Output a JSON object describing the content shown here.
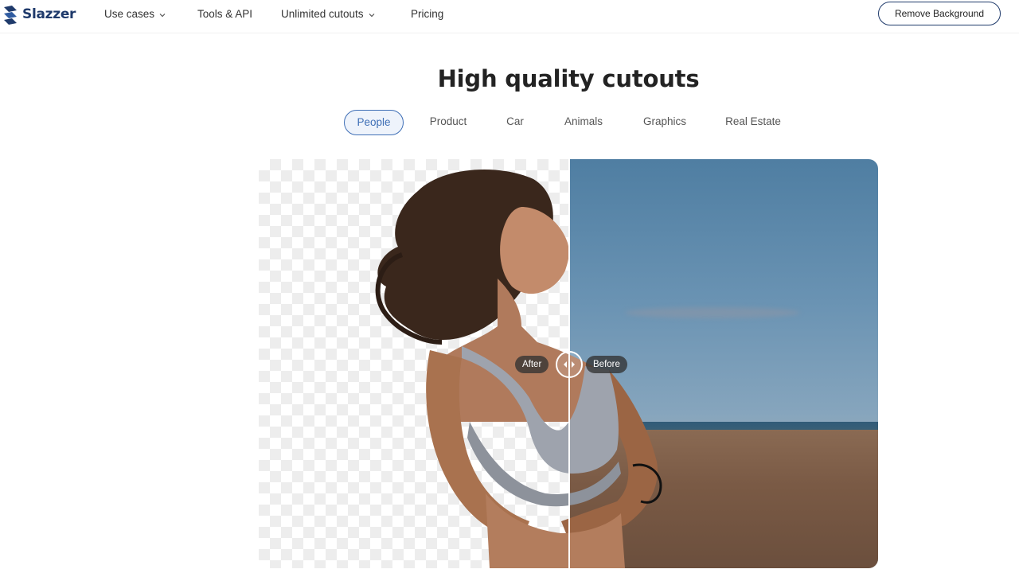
{
  "brand": {
    "name": "Slazzer",
    "logo_icon": "slazzer-logo-icon",
    "color": "#1f3a6b"
  },
  "nav": {
    "items": [
      {
        "label": "Use cases",
        "has_dropdown": true
      },
      {
        "label": "Tools & API",
        "has_dropdown": false
      },
      {
        "label": "Unlimited cutouts",
        "has_dropdown": true
      },
      {
        "label": "Pricing",
        "has_dropdown": false
      }
    ],
    "cta_label": "Remove Background"
  },
  "section": {
    "title": "High quality cutouts",
    "tabs": [
      {
        "label": "People",
        "active": true
      },
      {
        "label": "Product",
        "active": false
      },
      {
        "label": "Car",
        "active": false
      },
      {
        "label": "Animals",
        "active": false
      },
      {
        "label": "Graphics",
        "active": false
      },
      {
        "label": "Real Estate",
        "active": false
      }
    ],
    "accent_color": "#3f6fb6"
  },
  "compare": {
    "after_label": "After",
    "before_label": "Before",
    "slider_position": 0.5,
    "handle_icon": "arrows-left-right-icon"
  }
}
